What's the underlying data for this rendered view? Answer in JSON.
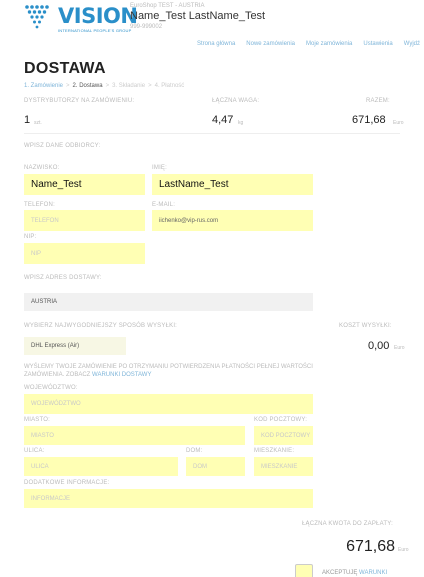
{
  "brand": {
    "logo_text": "VISION",
    "logo_subtext": "INTERNATIONAL PEOPLE'S GROUP",
    "accent": "#2a8fc9"
  },
  "header": {
    "shop_name": "EuroShop TEST - AUSTRIA",
    "user_name": "Name_Test LastName_Test",
    "user_id": "999-999002"
  },
  "nav": [
    {
      "label": "Strona główna"
    },
    {
      "label": "Nowe zamówienia"
    },
    {
      "label": "Moje zamówienia"
    },
    {
      "label": "Ustawienia"
    },
    {
      "label": "Wyjdź"
    }
  ],
  "page_title": "DOSTAWA",
  "steps": {
    "s1": "1. Zamówienie",
    "s2": "2. Dostawa",
    "s3": "3. Składanie",
    "s4": "4. Płatność",
    "sep": ">"
  },
  "summary": {
    "distributors_label": "DYSTRYBUTORZY NA ZAMÓWIENIU:",
    "distributors_value": "1",
    "distributors_unit": "szt.",
    "weight_label": "ŁĄCZNA WAGA:",
    "weight_value": "4,47",
    "weight_unit": "kg",
    "total_label": "RAZEM:",
    "total_value": "671,68",
    "total_unit": "Euro"
  },
  "recipient": {
    "section_label": "WPISZ DANE ODBIORCY:",
    "last_name_label": "NAZWISKO:",
    "last_name_value": "Name_Test",
    "first_name_label": "IMIĘ:",
    "first_name_value": "LastName_Test",
    "phone_label": "TELEFON:",
    "phone_placeholder": "TELEFON",
    "email_label": "E-MAIL:",
    "email_value": "iichenko@vip-rus.com",
    "nip_label": "NIP:",
    "nip_placeholder": "NIP"
  },
  "address": {
    "section_label": "WPISZ ADRES DOSTAWY:",
    "country_value": "AUSTRIA"
  },
  "shipping": {
    "method_label": "WYBIERZ NAJWYGODNIEJSZY SPOSÓB WYSYŁKI:",
    "method_value": "DHL Express (Air)",
    "cost_label": "KOSZT WYSYŁKI:",
    "cost_value": "0,00",
    "cost_unit": "Euro",
    "note_text": "WYŚLEMY TWOJE ZAMÓWIENIE PO OTRZYMANIU POTWIERDZENIA PŁATNOŚCI PEŁNEJ WARTOŚCI ZAMÓWIENIA. ZOBACZ",
    "note_link": "WARUNKI DOSTAWY"
  },
  "address_fields": {
    "region_label": "WOJEWÓDZTWO:",
    "region_placeholder": "WOJEWÓDZTWO",
    "city_label": "MIASTO:",
    "city_placeholder": "MIASTO",
    "zip_label": "KOD POCZTOWY:",
    "zip_placeholder": "KOD POCZTOWY",
    "street_label": "ULICA:",
    "street_placeholder": "ULICA",
    "house_label": "DOM:",
    "house_placeholder": "DOM",
    "apt_label": "MIESZKANIE:",
    "apt_placeholder": "MIESZKANIE",
    "info_label": "DODATKOWE INFORMACJE:",
    "info_placeholder": "INFORMACJE"
  },
  "footer": {
    "grand_total_label": "ŁĄCZNA KWOTA DO ZAPŁATY:",
    "grand_total_value": "671,68",
    "grand_total_unit": "Euro",
    "accept_label": "AKCEPTUJĘ",
    "accept_link": "WARUNKI"
  }
}
